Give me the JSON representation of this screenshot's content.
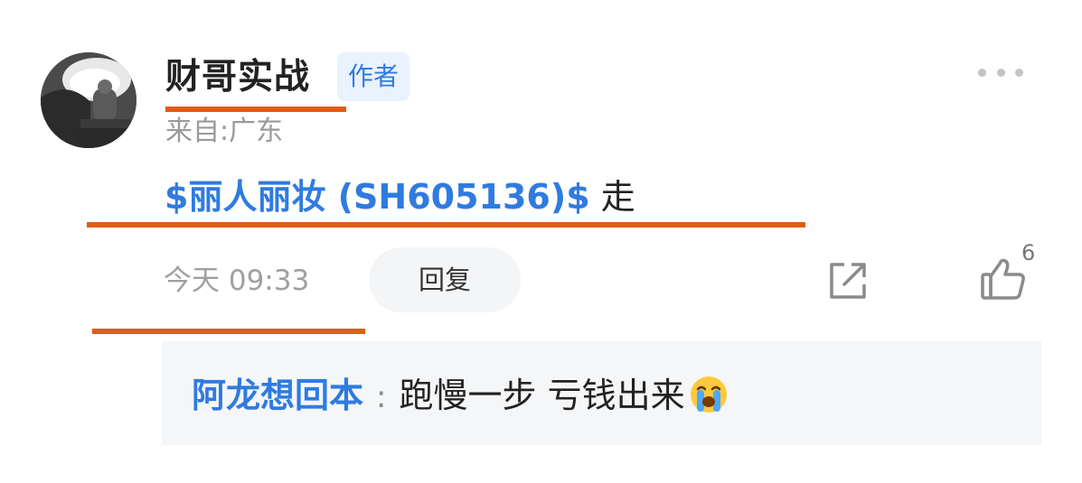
{
  "comment": {
    "username": "财哥实战",
    "author_badge": "作者",
    "location": "来自:广东",
    "stock_link": "$丽人丽妆 (SH605136)$",
    "text": " 走",
    "time": "今天 09:33",
    "reply_label": "回复",
    "like_count": "6"
  },
  "reply": {
    "user": "阿龙想回本",
    "separator": ":",
    "text": "跑慢一步  亏钱出来",
    "emoji": "crying-face-emoji"
  },
  "colors": {
    "link_blue": "#2f7be0",
    "annotation_underline": "#e35b15",
    "badge_bg": "#eaf2fd",
    "reply_bg": "#f5f6f8"
  },
  "icons": [
    "more-icon",
    "share-icon",
    "thumbs-up-icon",
    "crying-face-emoji"
  ]
}
